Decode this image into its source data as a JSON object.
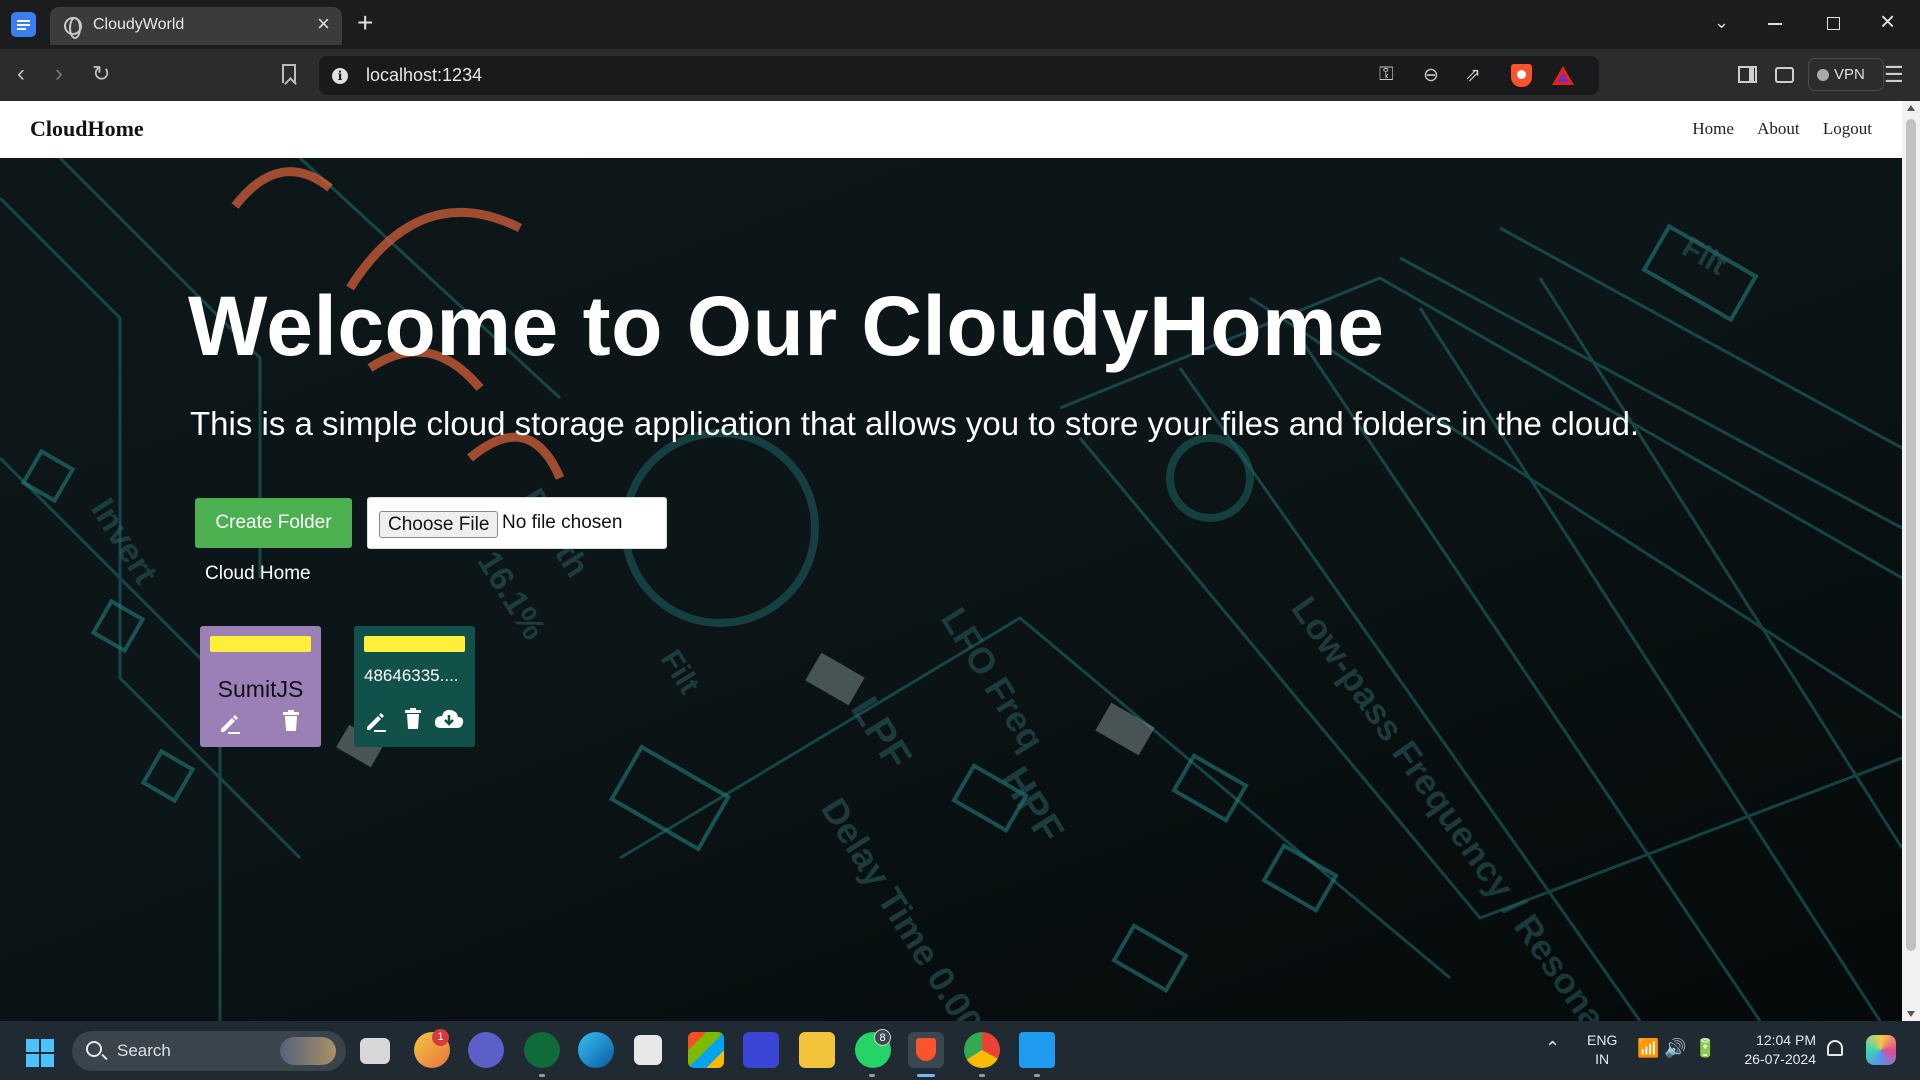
{
  "browser": {
    "tab_title": "CloudyWorld",
    "url": "localhost:1234",
    "vpn_label": "VPN"
  },
  "navbar": {
    "brand": "CloudHome",
    "links": [
      "Home",
      "About",
      "Logout"
    ]
  },
  "hero": {
    "headline": "Welcome to Our CloudyHome",
    "subline": "This is a simple cloud storage application that allows you to store your files and folders in the cloud."
  },
  "actions": {
    "create_folder_label": "Create Folder",
    "choose_file_label": "Choose File",
    "file_status": "No file chosen"
  },
  "breadcrumb": "Cloud Home",
  "items": [
    {
      "type": "folder",
      "name": "SumitJS",
      "color": "#9b80b8",
      "actions": [
        "edit-icon",
        "delete-icon"
      ]
    },
    {
      "type": "file",
      "name": "48646335....",
      "color": "#11514a",
      "actions": [
        "edit-icon",
        "delete-icon",
        "cloud-download-icon"
      ]
    }
  ],
  "taskbar": {
    "search_label": "Search",
    "notification_badge_mail": "1",
    "notification_badge_whatsapp": "8",
    "language_line1": "ENG",
    "language_line2": "IN",
    "time": "12:04 PM",
    "date": "26-07-2024"
  },
  "colors": {
    "create_button": "#4caf50",
    "folder_tab": "#ffee3a",
    "taskbar": "#1f2a33"
  }
}
